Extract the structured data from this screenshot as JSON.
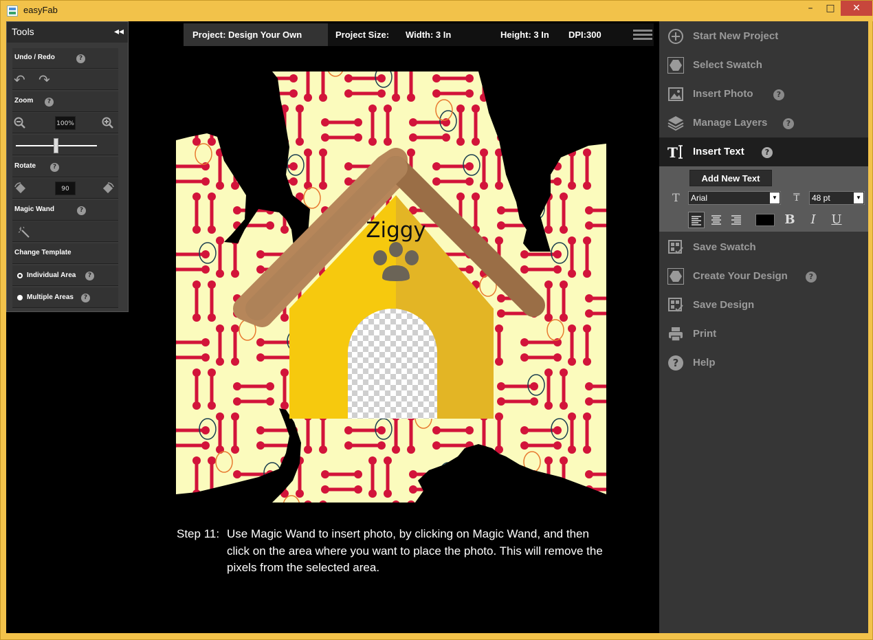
{
  "window": {
    "title": "easyFab",
    "min": "–",
    "max": "□",
    "close": "✕"
  },
  "tools": {
    "title": "Tools",
    "collapse": "◂◂",
    "undo_redo": "Undo / Redo",
    "zoom": "Zoom",
    "zoom_value": "100%",
    "rotate": "Rotate",
    "rotate_value": "90",
    "magic_wand": "Magic Wand",
    "change_template": "Change Template",
    "individual_area": "Individual Area",
    "multiple_areas": "Multiple Areas",
    "help": "?"
  },
  "project": {
    "name": "Project:  Design Your Own",
    "size_label": "Project Size:",
    "width": "Width: 3 In",
    "height": "Height: 3 In",
    "dpi": "DPI:300"
  },
  "canvas": {
    "label_text": "Ziggy",
    "background_color": "#fbfbbd",
    "bone_color": "#d2143a",
    "house_left": "#f6c90e",
    "house_right": "#e3b525",
    "roof_color": "#a87b4f"
  },
  "step": {
    "number": "Step 11:",
    "text": "Use Magic Wand to insert photo, by clicking on Magic Wand, and then click on the area where you want to place the photo. This will remove the pixels from the selected area."
  },
  "menu": {
    "start_new_project": "Start New Project",
    "select_swatch": "Select Swatch",
    "insert_photo": "Insert Photo",
    "manage_layers": "Manage Layers",
    "insert_text": "Insert Text",
    "save_swatch": "Save Swatch",
    "create_your_design": "Create Your Design",
    "save_design": "Save Design",
    "print": "Print",
    "help": "Help",
    "q": "?"
  },
  "text_tools": {
    "add_new_text": "Add New Text",
    "font": "Arial",
    "size": "48 pt",
    "bold": "B",
    "italic": "I",
    "underline": "U"
  }
}
